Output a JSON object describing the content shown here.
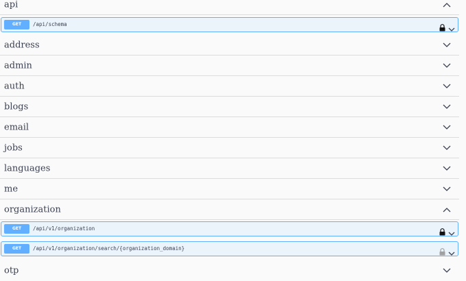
{
  "tags": {
    "api": {
      "label": "api",
      "expanded": true
    },
    "address": {
      "label": "address"
    },
    "admin": {
      "label": "admin"
    },
    "auth": {
      "label": "auth"
    },
    "blogs": {
      "label": "blogs"
    },
    "email": {
      "label": "email"
    },
    "jobs": {
      "label": "jobs"
    },
    "languages": {
      "label": "languages"
    },
    "me": {
      "label": "me"
    },
    "organization": {
      "label": "organization",
      "expanded": true
    },
    "otp": {
      "label": "otp"
    }
  },
  "operations": [
    {
      "method": "GET",
      "path": "/api/schema",
      "lock": "locked"
    },
    {
      "method": "GET",
      "path": "/api/v1/organization",
      "lock": "locked"
    },
    {
      "method": "GET",
      "path": "/api/v1/organization/search/{organization_domain}",
      "lock": "unlocked"
    }
  ],
  "colors": {
    "get_method": "#61affe",
    "get_background": "#ebf3fb",
    "text": "#3b4151",
    "divider": "#dcdcdc"
  }
}
